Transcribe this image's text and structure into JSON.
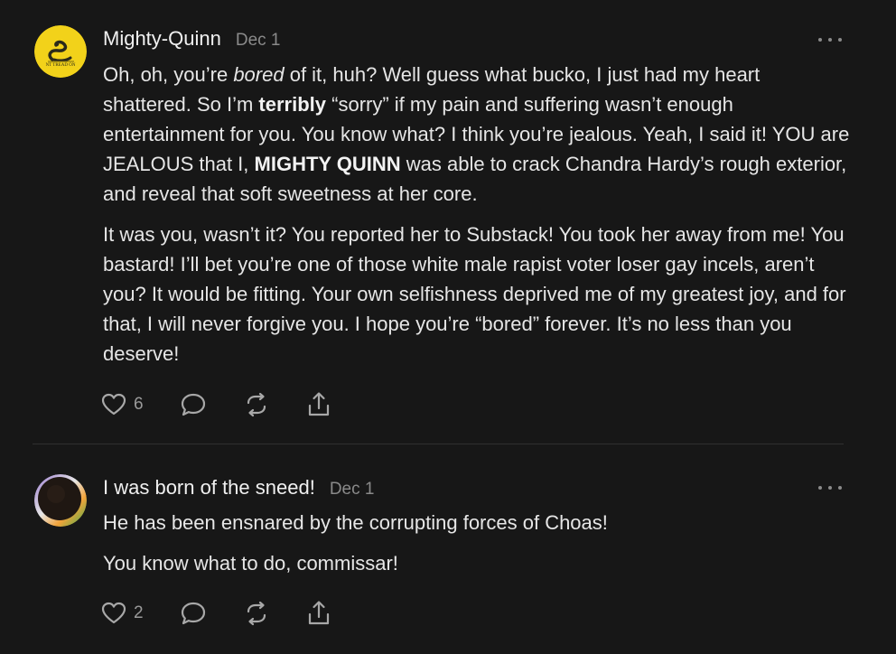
{
  "comments": [
    {
      "author": "Mighty-Quinn",
      "date": "Dec 1",
      "avatar_text": "NT TREAD ON",
      "paragraphs": [
        [
          {
            "t": "Oh, oh, you’re "
          },
          {
            "t": "bored",
            "style": "italic"
          },
          {
            "t": " of it, huh? Well guess what bucko, I just had my heart shattered. So I’m "
          },
          {
            "t": "terribly",
            "style": "bold"
          },
          {
            "t": " “sorry” if my pain and suffering wasn’t enough entertainment for you. You know what? I think you’re jealous. Yeah, I said it! YOU are JEALOUS that I, "
          },
          {
            "t": "MIGHTY QUINN",
            "style": "bold"
          },
          {
            "t": " was able to crack Chandra Hardy’s rough exterior, and reveal that soft sweetness at her core."
          }
        ],
        [
          {
            "t": "It was you, wasn’t it? You reported her to Substack! You took her away from me! You bastard! I’ll bet you’re one of those white male rapist voter loser gay incels, aren’t you? It would be fitting. Your own selfishness deprived me of my greatest joy, and for that, I will never forgive you. I hope you’re “bored” forever. It’s no less than you deserve!"
          }
        ]
      ],
      "likes": "6"
    },
    {
      "author": "I was born of the sneed!",
      "date": "Dec 1",
      "paragraphs": [
        [
          {
            "t": "He has been ensnared by the corrupting forces of Choas!"
          }
        ],
        [
          {
            "t": "You know what to do, commissar!"
          }
        ]
      ],
      "likes": "2"
    }
  ],
  "colors": {
    "background": "#171717",
    "avatar_yellow": "#f2d21a",
    "muted": "#8a8a8a"
  },
  "icons": [
    "heart-icon",
    "comment-icon",
    "restack-icon",
    "share-icon",
    "more-options-icon"
  ]
}
